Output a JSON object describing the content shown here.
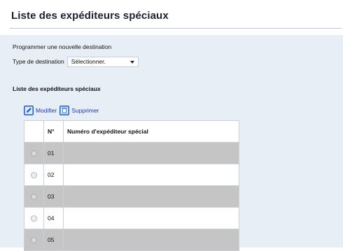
{
  "page": {
    "title": "Liste des expéditeurs spéciaux",
    "program_heading": "Programmer une nouvelle destination",
    "destination_type": {
      "label": "Type de destination",
      "selected": "Sélectionner."
    },
    "list_heading": "Liste des expéditeurs spéciaux"
  },
  "toolbar": {
    "modify_label": "Modifier",
    "delete_label": "Supprimer",
    "modify_icon": "edit-icon",
    "delete_icon": "delete-icon"
  },
  "table": {
    "columns": [
      "",
      "N°",
      "Numéro d'expéditeur spécial"
    ],
    "rows": [
      {
        "number": "01",
        "sender": ""
      },
      {
        "number": "02",
        "sender": ""
      },
      {
        "number": "03",
        "sender": ""
      },
      {
        "number": "04",
        "sender": ""
      },
      {
        "number": "05",
        "sender": ""
      }
    ]
  },
  "colors": {
    "page_background": "#e7eef6",
    "shaded_row": "#c5c5c5",
    "link": "#1e3aa8"
  }
}
